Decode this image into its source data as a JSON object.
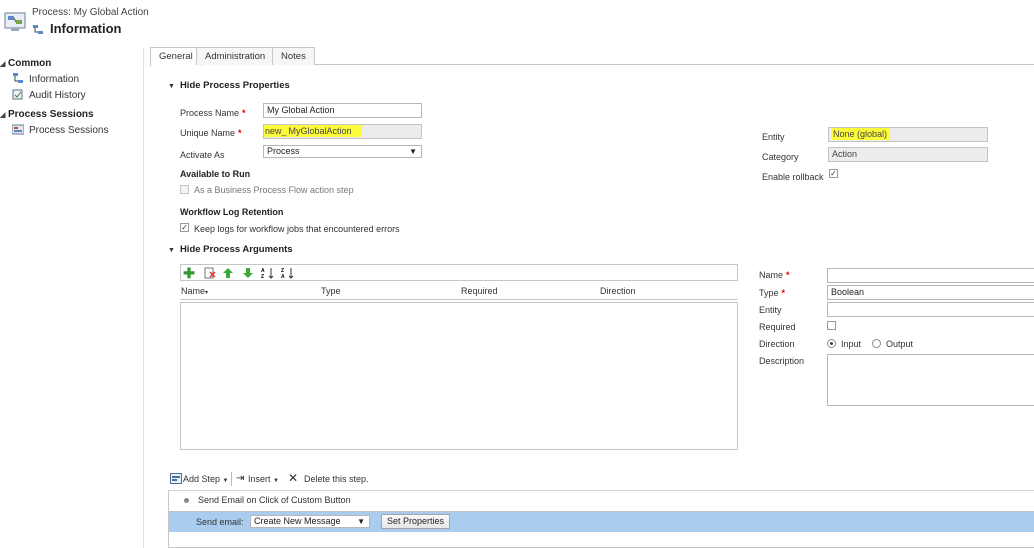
{
  "header": {
    "subtitle": "Process: My Global Action",
    "title": "Information"
  },
  "nav": {
    "groups": [
      {
        "label": "Common",
        "items": [
          "Information",
          "Audit History"
        ]
      },
      {
        "label": "Process Sessions",
        "items": [
          "Process Sessions"
        ]
      }
    ]
  },
  "tabs": [
    "General",
    "Administration",
    "Notes"
  ],
  "properties": {
    "section_title": "Hide Process Properties",
    "process_name_label": "Process Name",
    "process_name_value": "My Global Action",
    "unique_name_label": "Unique Name",
    "unique_name_prefix": "new_",
    "unique_name_value": "MyGlobalAction",
    "activate_as_label": "Activate As",
    "activate_as_value": "Process",
    "available_to_run_label": "Available to Run",
    "bpf_step_label": "As a Business Process Flow action step",
    "log_retention_label": "Workflow Log Retention",
    "keep_logs_label": "Keep logs for workflow jobs that encountered errors",
    "entity_label": "Entity",
    "entity_value": "None (global)",
    "category_label": "Category",
    "category_value": "Action",
    "rollback_label": "Enable rollback"
  },
  "arguments": {
    "section_title": "Hide Process Arguments",
    "columns": [
      "Name",
      "Type",
      "Required",
      "Direction"
    ],
    "name_label": "Name",
    "type_label": "Type",
    "type_value": "Boolean",
    "entity_label": "Entity",
    "required_label": "Required",
    "direction_label": "Direction",
    "direction_input": "Input",
    "direction_output": "Output",
    "description_label": "Description"
  },
  "steps": {
    "add_step": "Add Step",
    "insert": "Insert",
    "delete": "Delete this step.",
    "step_title": "Send Email on Click of Custom Button",
    "send_email_label": "Send email:",
    "send_email_option": "Create New Message",
    "set_properties": "Set Properties"
  },
  "colors": {
    "highlight": "#fcfc3a",
    "selected_row": "#aaccee",
    "required": "#e00000"
  }
}
